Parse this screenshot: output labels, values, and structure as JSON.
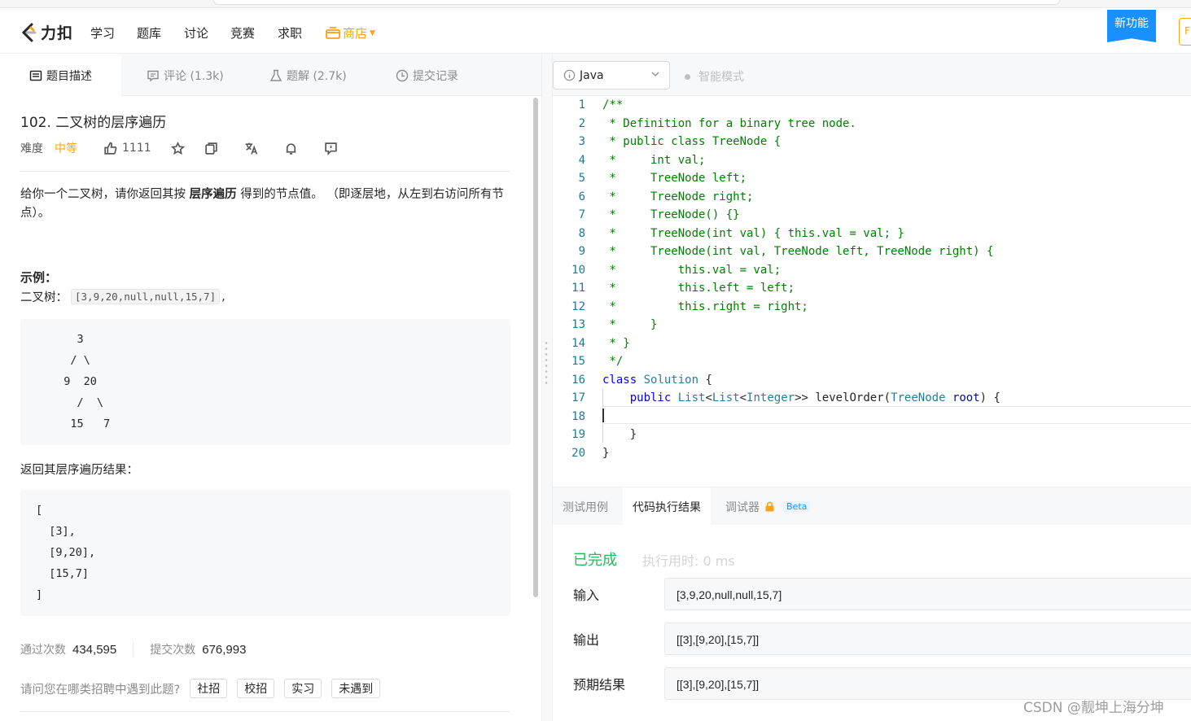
{
  "nav": {
    "logo_text": "力扣",
    "items": [
      "学习",
      "题库",
      "讨论",
      "竞赛",
      "求职"
    ],
    "shop_label": "商店",
    "new_feature": "新功能",
    "right_btn": "F"
  },
  "left_tabs": [
    {
      "label": "题目描述",
      "icon": "document-icon"
    },
    {
      "label": "评论 (1.3k)",
      "icon": "comment-icon"
    },
    {
      "label": "题解 (2.7k)",
      "icon": "flask-icon"
    },
    {
      "label": "提交记录",
      "icon": "clock-icon"
    }
  ],
  "problem": {
    "title": "102. 二叉树的层序遍历",
    "difficulty_label": "难度",
    "difficulty": "中等",
    "likes": "1111",
    "desc_pre": "给你一个二叉树，请你返回其按 ",
    "desc_bold": "层序遍历",
    "desc_post": " 得到的节点值。 （即逐层地，从左到右访问所有节点）。",
    "example_heading": "示例：",
    "example_label": "二叉树：",
    "example_input": "[3,9,20,null,null,15,7]",
    "example_suffix": ",",
    "tree_art": "    3\n   / \\\n  9  20\n    /  \\\n   15   7",
    "result_label": "返回其层序遍历结果：",
    "result_art": "[\n  [3],\n  [9,20],\n  [15,7]\n]",
    "accepted_label": "通过次数",
    "accepted": "434,595",
    "submitted_label": "提交次数",
    "submitted": "676,993",
    "ask": "请问您在哪类招聘中遇到此题?",
    "tags": [
      "社招",
      "校招",
      "实习",
      "未遇到"
    ]
  },
  "editor": {
    "language": "Java",
    "smart_mode": "智能模式",
    "lines": [
      "/**",
      " * Definition for a binary tree node.",
      " * public class TreeNode {",
      " *     int val;",
      " *     TreeNode left;",
      " *     TreeNode right;",
      " *     TreeNode() {}",
      " *     TreeNode(int val) { this.val = val; }",
      " *     TreeNode(int val, TreeNode left, TreeNode right) {",
      " *         this.val = val;",
      " *         this.left = left;",
      " *         this.right = right;",
      " *     }",
      " * }",
      " */",
      "class Solution {",
      "    public List<List<Integer>> levelOrder(TreeNode root) {",
      "        ",
      "    }",
      "}"
    ],
    "colors": {
      "comment": "#008000",
      "keyword": "#0000ff",
      "type": "#267f99",
      "linenum": "#237893"
    }
  },
  "console": {
    "tabs": [
      "测试用例",
      "代码执行结果",
      "调试器"
    ],
    "beta": "Beta",
    "status": "已完成",
    "runtime": "执行用时: 0 ms",
    "rows": [
      {
        "label": "输入",
        "value": "[3,9,20,null,null,15,7]"
      },
      {
        "label": "输出",
        "value": "[[3],[9,20],[15,7]]"
      },
      {
        "label": "预期结果",
        "value": "[[3],[9,20],[15,7]]"
      }
    ]
  },
  "watermark": "CSDN @靓坤上海分坤"
}
